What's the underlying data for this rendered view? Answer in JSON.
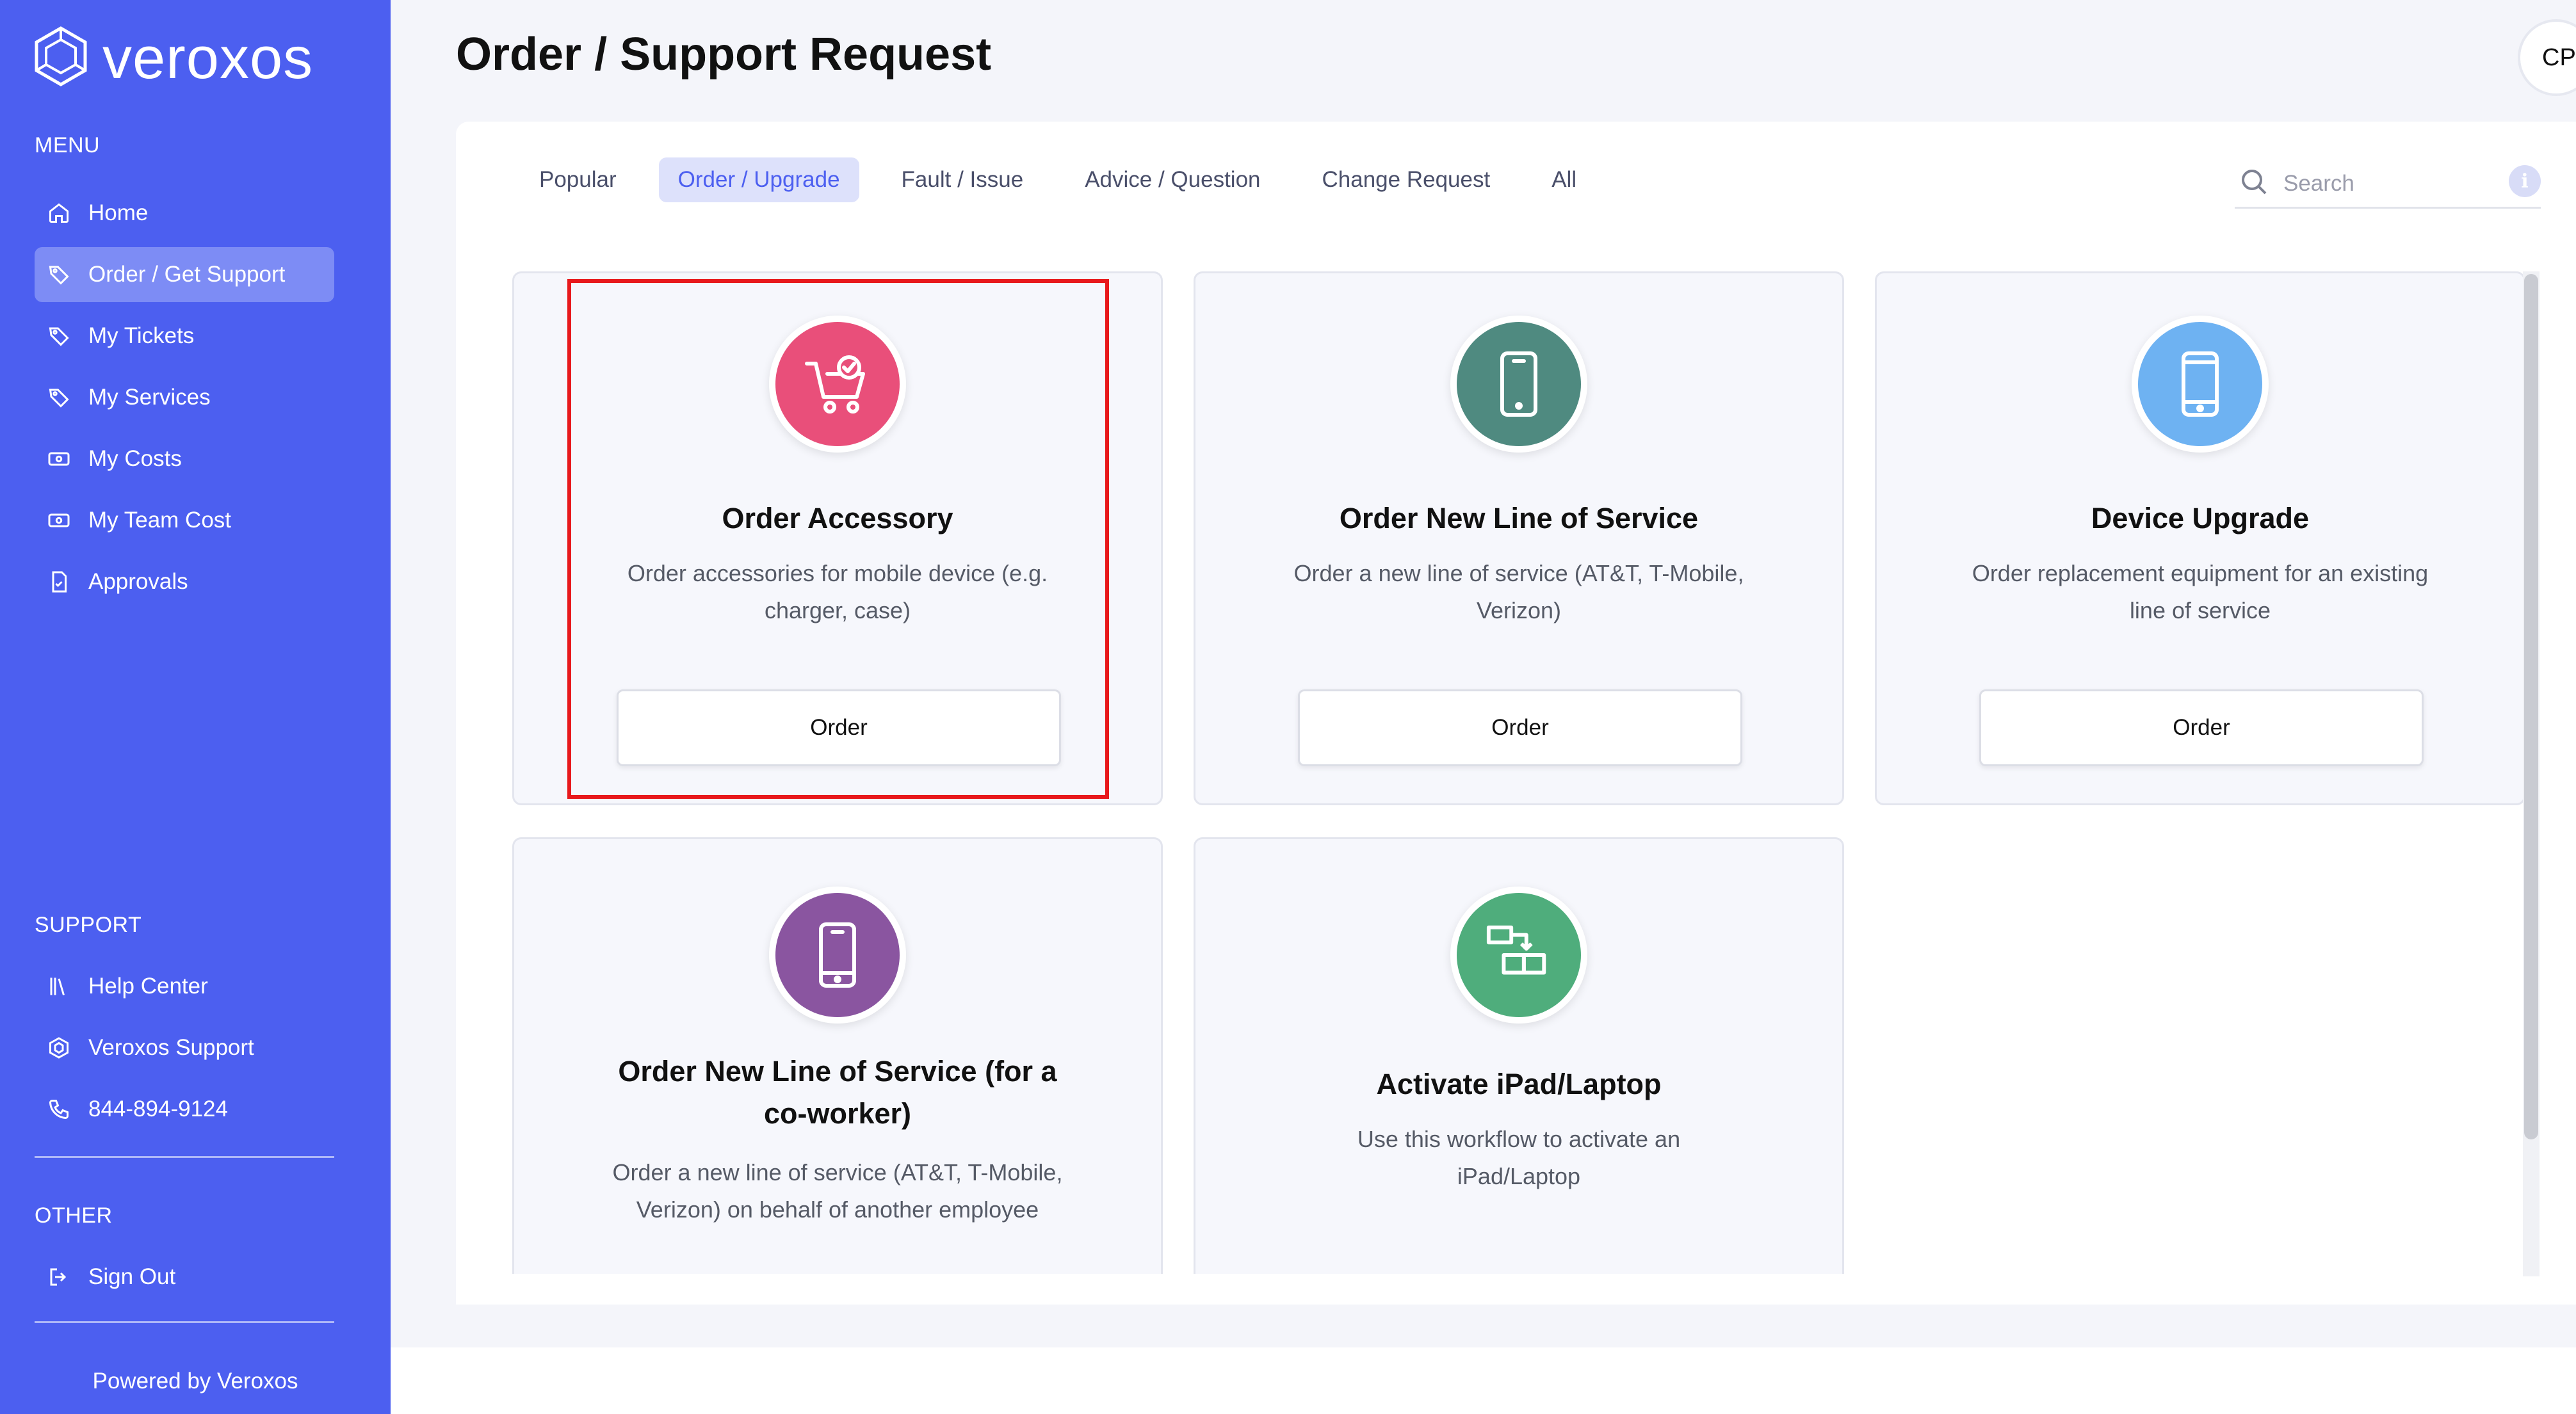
{
  "app": {
    "brand": "veroxos",
    "powered_by": "Powered by Veroxos"
  },
  "sidebar": {
    "menu_title": "MENU",
    "menu_items": [
      {
        "label": "Home",
        "icon": "home-icon"
      },
      {
        "label": "Order / Get Support",
        "icon": "tag-icon",
        "active": true
      },
      {
        "label": "My Tickets",
        "icon": "tag-icon"
      },
      {
        "label": "My Services",
        "icon": "tag-icon"
      },
      {
        "label": "My Costs",
        "icon": "cash-icon"
      },
      {
        "label": "My Team Cost",
        "icon": "cash-icon"
      },
      {
        "label": "Approvals",
        "icon": "document-icon"
      }
    ],
    "support_title": "SUPPORT",
    "support_items": [
      {
        "label": "Help Center",
        "icon": "books-icon"
      },
      {
        "label": "Veroxos Support",
        "icon": "hexagon-icon"
      },
      {
        "label": "844-894-9124",
        "icon": "phone-icon"
      }
    ],
    "other_title": "OTHER",
    "other_items": [
      {
        "label": "Sign Out",
        "icon": "sign-out-icon"
      }
    ]
  },
  "header": {
    "title": "Order / Support Request",
    "avatar_initials": "CP"
  },
  "tabs": [
    {
      "label": "Popular"
    },
    {
      "label": "Order / Upgrade",
      "active": true
    },
    {
      "label": "Fault / Issue"
    },
    {
      "label": "Advice / Question"
    },
    {
      "label": "Change Request"
    },
    {
      "label": "All"
    }
  ],
  "search": {
    "placeholder": "Search",
    "value": ""
  },
  "cards": [
    {
      "title": "Order Accessory",
      "description": "Order accessories for mobile device (e.g. charger, case)",
      "button": "Order",
      "icon": "cart-check-icon",
      "color": "#e94f7a"
    },
    {
      "title": "Order New Line of Service",
      "description": "Order a new line of service (AT&T, T-Mobile, Verizon)",
      "button": "Order",
      "icon": "phone-device-icon",
      "color": "#4f8a80"
    },
    {
      "title": "Device Upgrade",
      "description": "Order replacement equipment for an existing line of service",
      "button": "Order",
      "icon": "phone-device-icon",
      "color": "#6eb2f2"
    },
    {
      "title": "Order New Line of Service (for a co-worker)",
      "description": "Order a new line of service (AT&T, T-Mobile, Verizon) on behalf of another employee",
      "button": "",
      "icon": "phone-device-icon",
      "color": "#8a55a0"
    },
    {
      "title": "Activate iPad/Laptop",
      "description": "Use this workflow to activate an iPad/Laptop",
      "button": "",
      "icon": "workflow-icon",
      "color": "#4fad7c"
    }
  ],
  "colors": {
    "sidebar": "#4c5ff0",
    "accent": "#4c5ff0",
    "highlight": "#e8191c"
  }
}
